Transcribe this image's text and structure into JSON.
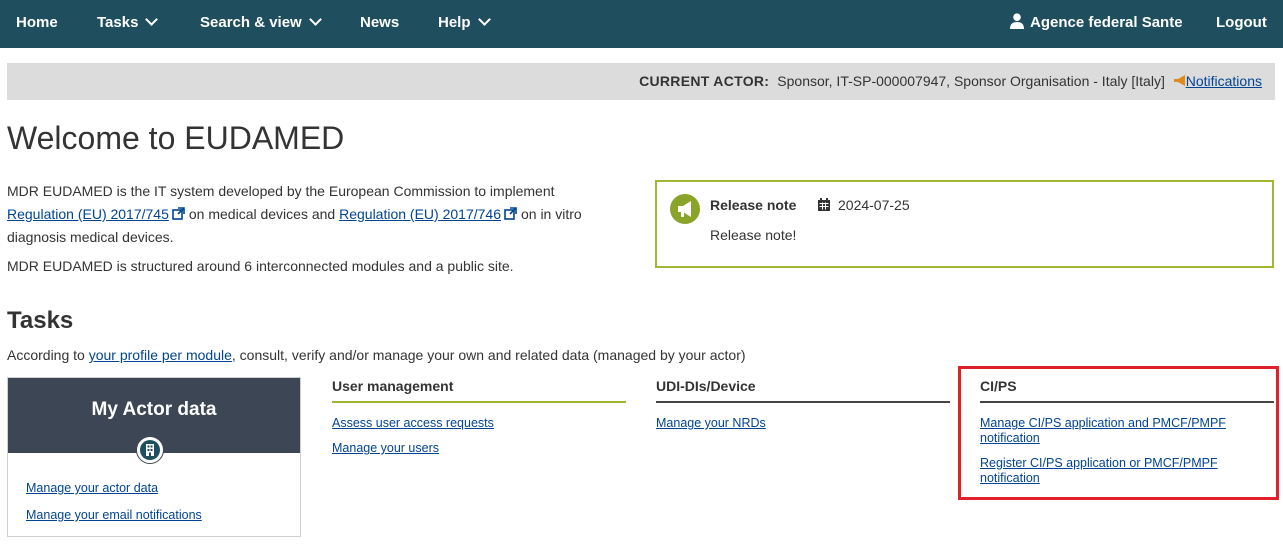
{
  "nav": {
    "home": "Home",
    "tasks": "Tasks",
    "search_view": "Search & view",
    "news": "News",
    "help": "Help",
    "user": "Agence federal Sante",
    "logout": "Logout"
  },
  "actor_bar": {
    "label": "CURRENT ACTOR:",
    "value": "Sponsor, IT-SP-000007947, Sponsor Organisation - Italy [Italy]",
    "notifications": "Notifications"
  },
  "welcome": {
    "title": "Welcome to EUDAMED",
    "intro_1": "MDR EUDAMED is the IT system developed by the European Commission to implement",
    "reg_745": "Regulation (EU) 2017/745",
    "intro_2": "on medical devices and",
    "reg_746": "Regulation (EU) 2017/746",
    "intro_3": "on in vitro diagnosis medical devices.",
    "intro_4": "MDR EUDAMED is structured around 6 interconnected modules and a public site."
  },
  "release_note": {
    "title": "Release note",
    "date": "2024-07-25",
    "body": "Release note!"
  },
  "tasks": {
    "heading": "Tasks",
    "intro_pre": "According to",
    "intro_link": "your profile per module",
    "intro_post": ", consult, verify and/or manage your own and related data (managed by your actor)",
    "actor_card": {
      "title": "My Actor data",
      "links": [
        "Manage your actor data",
        "Manage your email notifications"
      ]
    },
    "user_management": {
      "title": "User management",
      "links": [
        "Assess user access requests",
        "Manage your users"
      ]
    },
    "udi": {
      "title": "UDI-DIs/Device",
      "links": [
        "Manage your NRDs"
      ]
    },
    "cips": {
      "title": "CI/PS",
      "links": [
        "Manage CI/PS application and PMCF/PMPF notification",
        "Register CI/PS application or PMCF/PMPF notification"
      ]
    }
  },
  "colors": {
    "nav_bg": "#1f4f5f",
    "accent_green": "#a3b633",
    "highlight_red": "#e0202a",
    "link": "#004494"
  }
}
